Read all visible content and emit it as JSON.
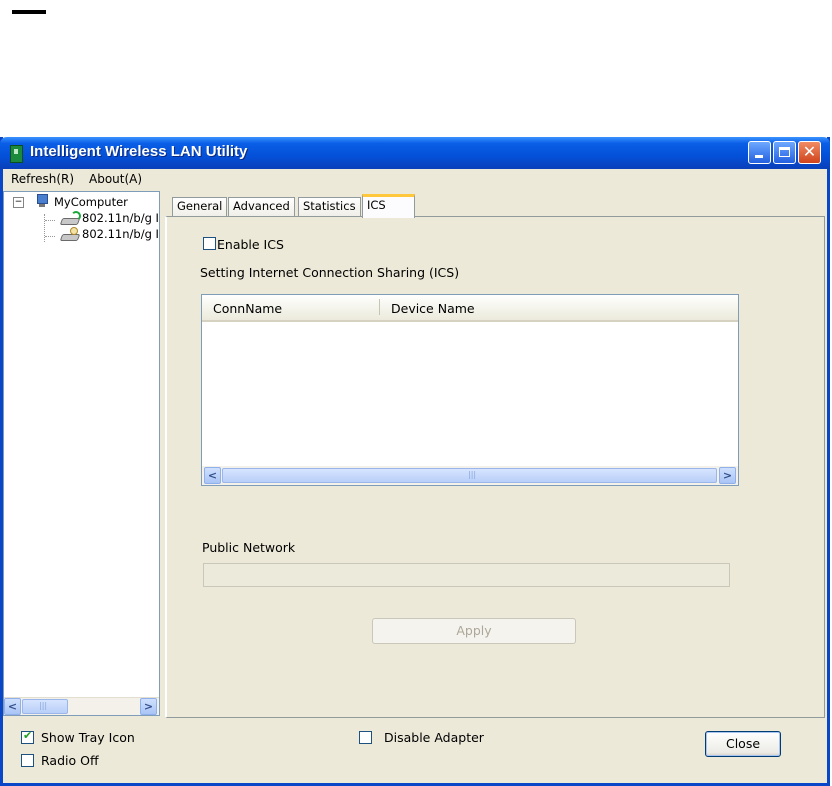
{
  "window": {
    "title": "Intelligent Wireless LAN Utility",
    "controls": {
      "minimize": "",
      "maximize": "",
      "close": "✕"
    }
  },
  "menu": {
    "refresh": "Refresh(R)",
    "about": "About(A)"
  },
  "tree": {
    "root": "MyComputer",
    "expander": "−",
    "children": [
      "802.11n/b/g I",
      "802.11n/b/g I"
    ]
  },
  "tabs": [
    {
      "label": "General",
      "selected": false
    },
    {
      "label": "Advanced",
      "selected": false
    },
    {
      "label": "Statistics",
      "selected": false
    },
    {
      "label": "ICS",
      "selected": true
    }
  ],
  "ics": {
    "enable_label": "Enable ICS",
    "enabled": false,
    "section_title": "Setting Internet Connection Sharing (ICS)",
    "columns": [
      "ConnName",
      "Device Name"
    ],
    "rows": [],
    "public_network_label": "Public Network",
    "public_network_value": "",
    "apply_label": "Apply"
  },
  "footer": {
    "show_tray_icon": {
      "label": "Show Tray Icon",
      "checked": true
    },
    "radio_off": {
      "label": "Radio Off",
      "checked": false
    },
    "disable_adapter": {
      "label": "Disable Adapter",
      "checked": false
    },
    "close_label": "Close"
  },
  "scroll_glyphs": {
    "left": "<",
    "right": ">",
    "grip": "|||"
  },
  "colors": {
    "title_bar": "#0450d8",
    "close_button": "#d0431c",
    "tab_highlight": "#ffc83c",
    "window_bg": "#ece9d8"
  }
}
